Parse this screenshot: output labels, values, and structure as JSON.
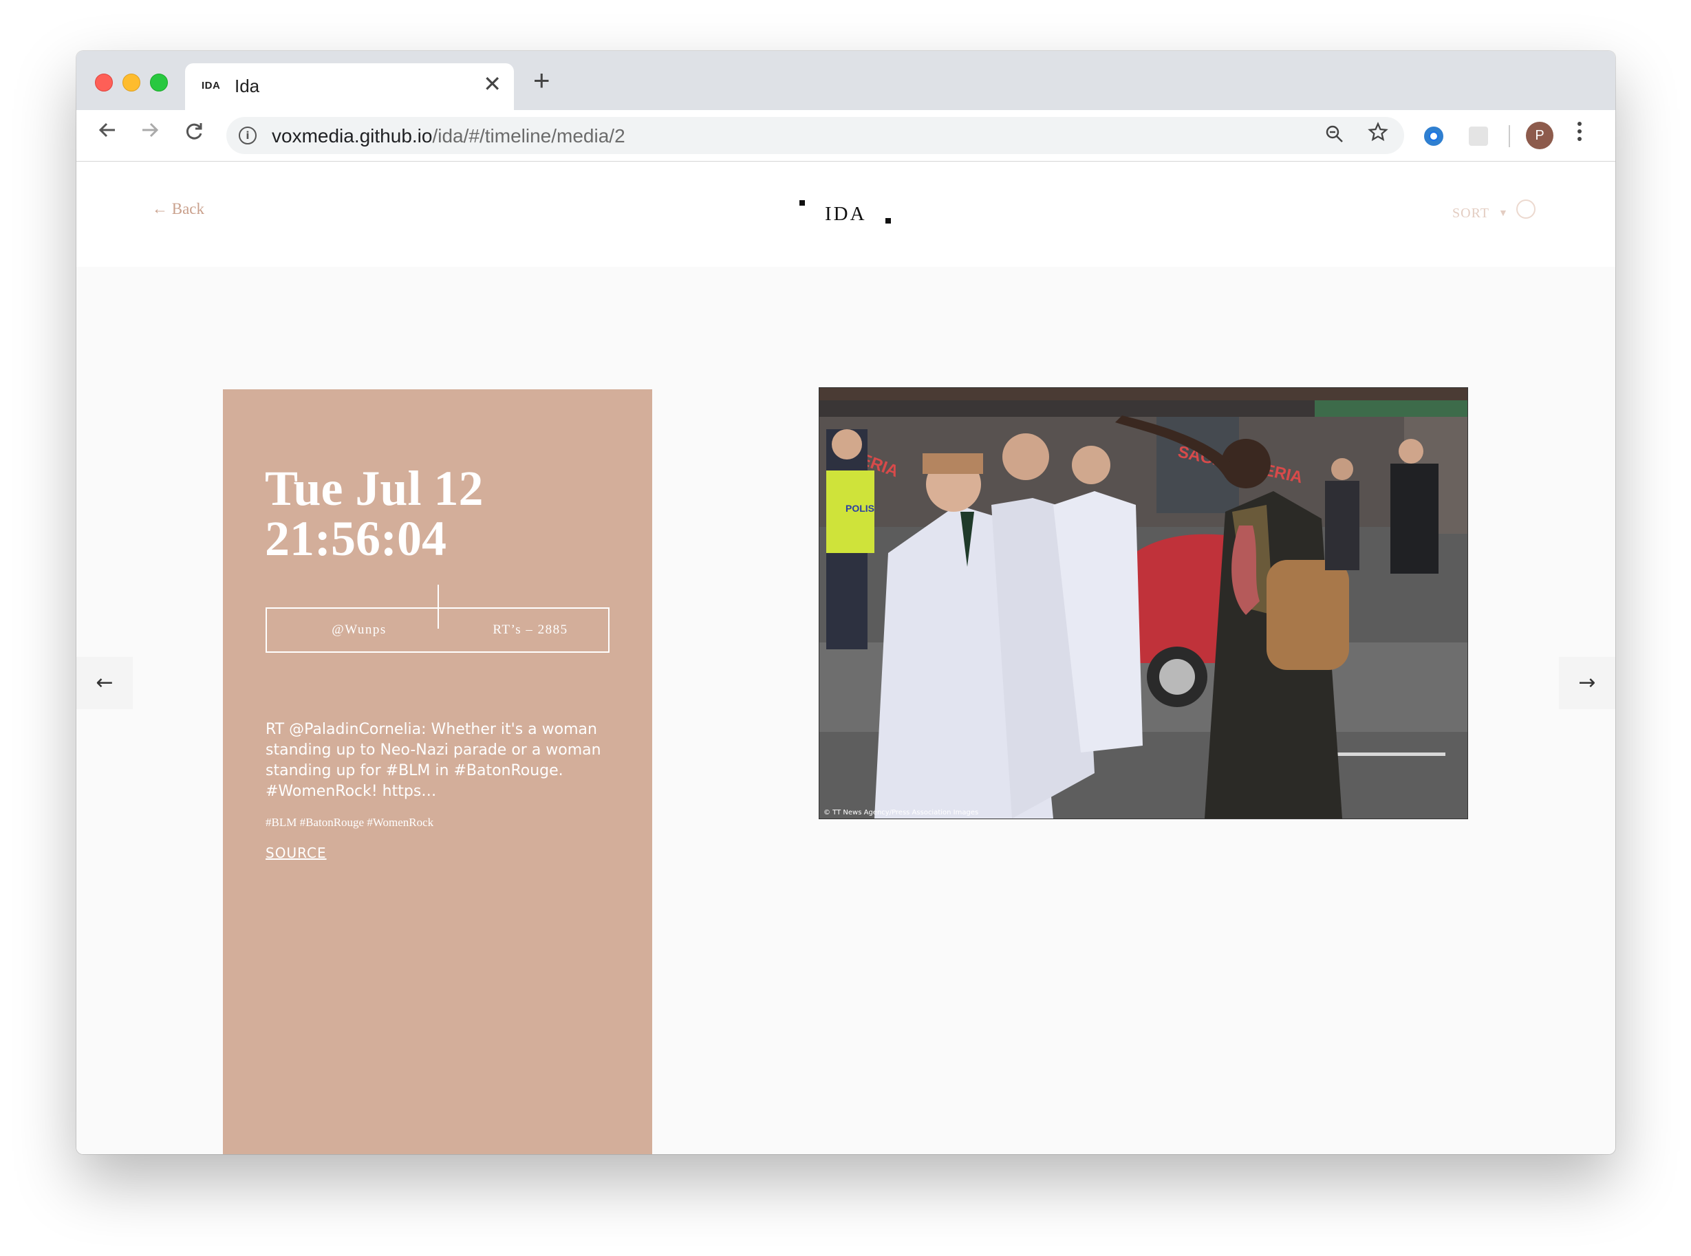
{
  "browser": {
    "tab": {
      "favicon_text": "IDA",
      "title": "Ida",
      "close_glyph": "✕"
    },
    "new_tab_glyph": "+",
    "url_host": "voxmedia.github.io",
    "url_path": "/ida/#/timeline/media/2",
    "profile_initial": "P",
    "icons": [
      "back-icon",
      "forward-icon",
      "reload-icon",
      "info-icon",
      "zoom-icon",
      "star-icon",
      "extension-icon",
      "menu-icon"
    ]
  },
  "header": {
    "back_label": "← Back",
    "logo": "IDA",
    "sort_label": "SORT"
  },
  "nav": {
    "prev_glyph": "←",
    "next_glyph": "→"
  },
  "card": {
    "date_line1": "Tue Jul 12",
    "date_line2": "21:56:04",
    "user": "@Wunps",
    "retweets": "RT’s – 2885",
    "tweet_text": "RT @PaladinCornelia: Whether it's a woman standing up to Neo-Nazi parade or a woman standing up for #BLM in #BatonRouge. #WomenRock! https…",
    "hashtags": "#BLM #BatonRouge #WomenRock",
    "source_label": "SOURCE",
    "background": "#d3ae9a"
  },
  "media": {
    "credit": "© TT News Agency/Press Association Images",
    "shop_sign_1": "ZZERIA",
    "shop_sign_2": "SAGA PIZZERIA",
    "police_label": "POLIS"
  }
}
